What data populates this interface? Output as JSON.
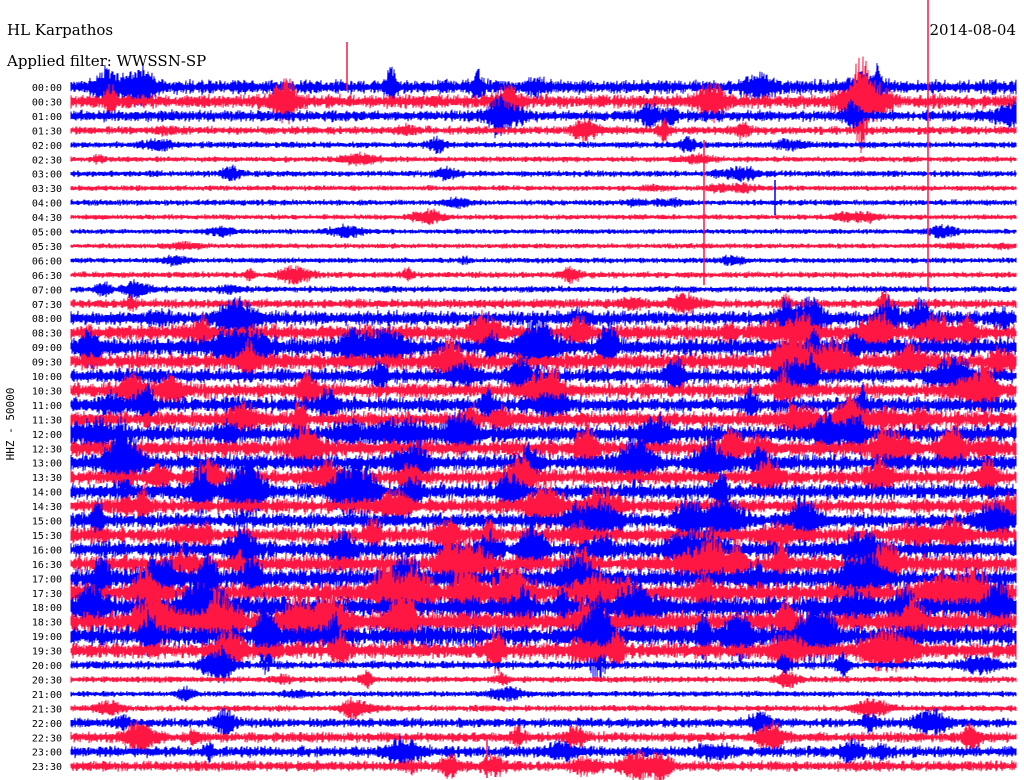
{
  "header": {
    "station": "HL Karpathos",
    "date": "2014-08-04",
    "filter": "Applied filter: WWSSN-SP"
  },
  "chart_data": {
    "type": "line",
    "title": "HL Karpathos",
    "subtitle": "Applied filter: WWSSN-SP",
    "ylabel": "HHZ - 50000",
    "colors": {
      "odd_rows": "#0000ff",
      "even_rows": "#ff1744"
    },
    "rows": [
      {
        "label": "00:00",
        "activity": 0.55
      },
      {
        "label": "00:30",
        "activity": 0.55
      },
      {
        "label": "01:00",
        "activity": 0.4
      },
      {
        "label": "01:30",
        "activity": 0.25
      },
      {
        "label": "02:00",
        "activity": 0.15
      },
      {
        "label": "02:30",
        "activity": 0.12
      },
      {
        "label": "03:00",
        "activity": 0.15
      },
      {
        "label": "03:30",
        "activity": 0.1
      },
      {
        "label": "04:00",
        "activity": 0.12
      },
      {
        "label": "04:30",
        "activity": 0.1
      },
      {
        "label": "05:00",
        "activity": 0.08
      },
      {
        "label": "05:30",
        "activity": 0.08
      },
      {
        "label": "06:00",
        "activity": 0.1
      },
      {
        "label": "06:30",
        "activity": 0.15
      },
      {
        "label": "07:00",
        "activity": 0.15
      },
      {
        "label": "07:30",
        "activity": 0.3
      },
      {
        "label": "08:00",
        "activity": 0.55
      },
      {
        "label": "08:30",
        "activity": 0.65
      },
      {
        "label": "09:00",
        "activity": 0.75
      },
      {
        "label": "09:30",
        "activity": 0.7
      },
      {
        "label": "10:00",
        "activity": 0.6
      },
      {
        "label": "10:30",
        "activity": 0.6
      },
      {
        "label": "11:00",
        "activity": 0.6
      },
      {
        "label": "11:30",
        "activity": 0.65
      },
      {
        "label": "12:00",
        "activity": 0.7
      },
      {
        "label": "12:30",
        "activity": 0.7
      },
      {
        "label": "13:00",
        "activity": 0.65
      },
      {
        "label": "13:30",
        "activity": 0.6
      },
      {
        "label": "14:00",
        "activity": 0.65
      },
      {
        "label": "14:30",
        "activity": 0.6
      },
      {
        "label": "15:00",
        "activity": 0.6
      },
      {
        "label": "15:30",
        "activity": 0.65
      },
      {
        "label": "16:00",
        "activity": 0.7
      },
      {
        "label": "16:30",
        "activity": 0.75
      },
      {
        "label": "17:00",
        "activity": 0.8
      },
      {
        "label": "17:30",
        "activity": 0.85
      },
      {
        "label": "18:00",
        "activity": 0.9
      },
      {
        "label": "18:30",
        "activity": 0.9
      },
      {
        "label": "19:00",
        "activity": 0.9
      },
      {
        "label": "19:30",
        "activity": 0.65
      },
      {
        "label": "20:00",
        "activity": 0.25
      },
      {
        "label": "20:30",
        "activity": 0.15
      },
      {
        "label": "21:00",
        "activity": 0.12
      },
      {
        "label": "21:30",
        "activity": 0.15
      },
      {
        "label": "22:00",
        "activity": 0.3
      },
      {
        "label": "22:30",
        "activity": 0.35
      },
      {
        "label": "23:00",
        "activity": 0.4
      },
      {
        "label": "23:30",
        "activity": 0.35
      }
    ]
  }
}
